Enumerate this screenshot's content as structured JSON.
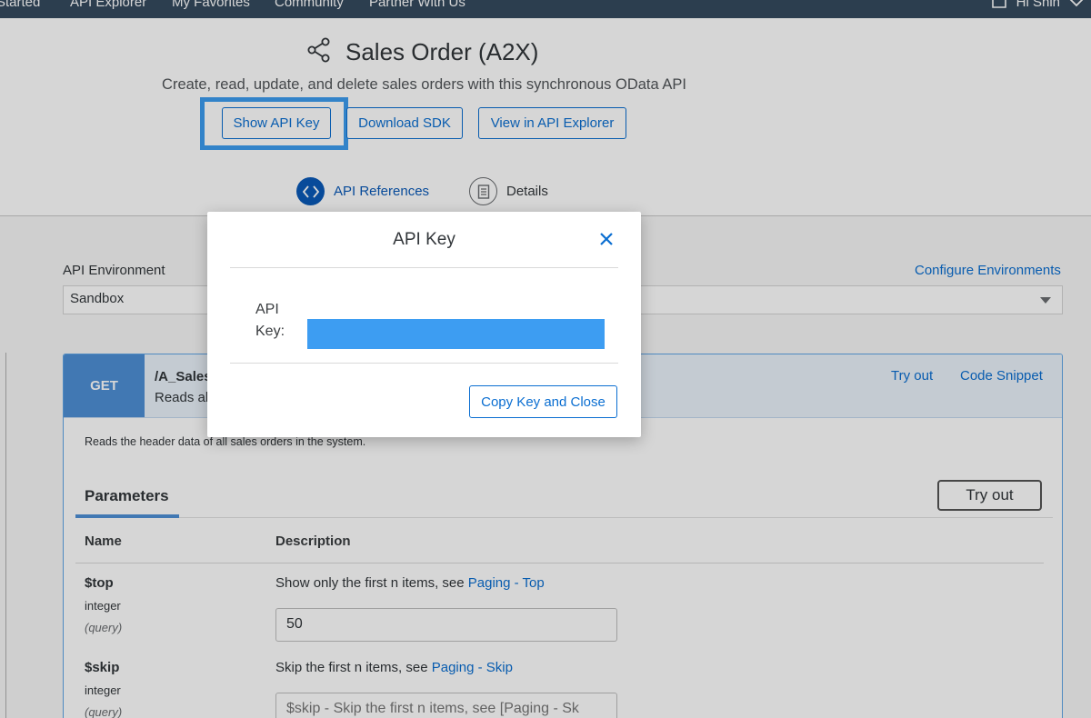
{
  "nav": {
    "items": [
      "Started",
      "API Explorer",
      "My Favorites",
      "Community",
      "Partner With Us"
    ],
    "greeting": "Hi Shin"
  },
  "header": {
    "title": "Sales Order (A2X)",
    "subtitle": "Create, read, update, and delete sales orders with this synchronous OData API",
    "buttons": {
      "show_api_key": "Show API Key",
      "download_sdk": "Download SDK",
      "view_in_explorer": "View in API Explorer"
    },
    "tabs": {
      "api_references": "API References",
      "details": "Details"
    }
  },
  "environment": {
    "label": "API Environment",
    "configure_link": "Configure Environments",
    "selected": "Sandbox"
  },
  "operation": {
    "method": "GET",
    "path": "/A_Sales",
    "summary": "Reads al",
    "try_out": "Try out",
    "code_snippet": "Code Snippet",
    "description": "Reads the header data of all sales orders in the system."
  },
  "parameters": {
    "tab_label": "Parameters",
    "try_out_button": "Try out",
    "col_name": "Name",
    "col_description": "Description",
    "rows": [
      {
        "name": "$top",
        "type": "integer",
        "in": "(query)",
        "desc_prefix": "Show only the first n items, see ",
        "desc_link": "Paging - Top",
        "value": "50"
      },
      {
        "name": "$skip",
        "type": "integer",
        "in": "(query)",
        "desc_prefix": "Skip the first n items, see ",
        "desc_link": "Paging - Skip",
        "placeholder": "$skip - Skip the first n items, see [Paging - Sk"
      }
    ]
  },
  "dialog": {
    "title": "API Key",
    "key_label": "API Key:",
    "copy_button": "Copy Key and Close"
  },
  "colors": {
    "nav_bg": "#354a5f",
    "accent": "#0a6ed1",
    "highlight": "#3c9df0",
    "masked_key": "#3d9df2",
    "get_badge": "#4e8fd6"
  }
}
